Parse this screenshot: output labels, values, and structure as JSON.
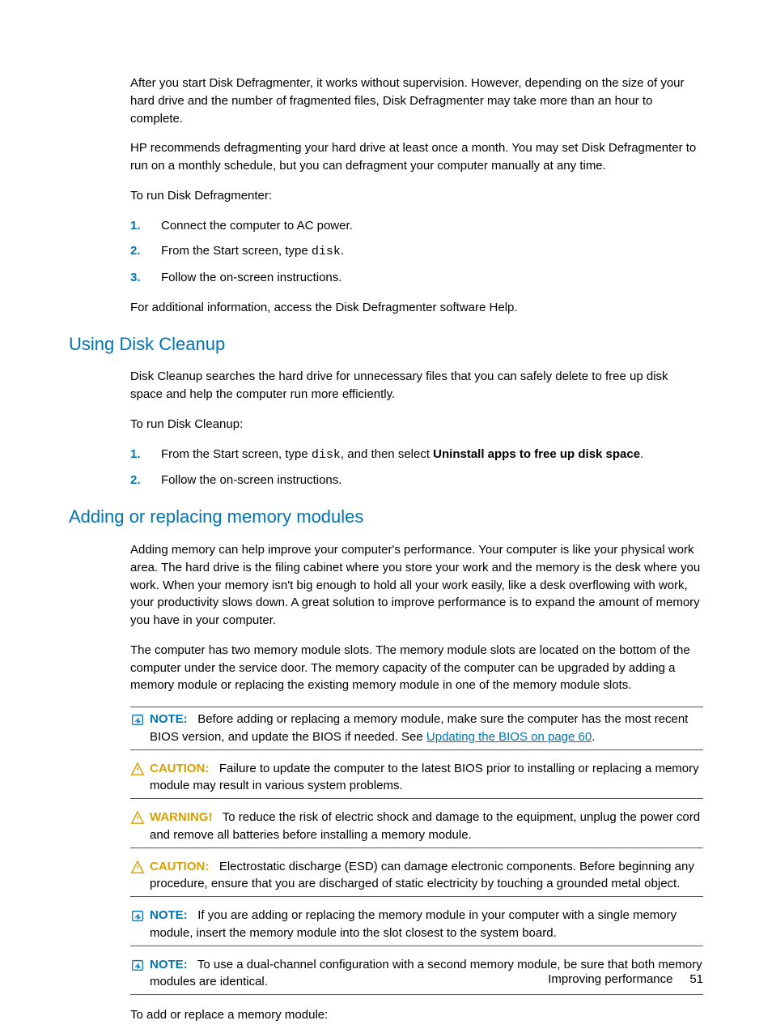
{
  "intro": {
    "p1": "After you start Disk Defragmenter, it works without supervision. However, depending on the size of your hard drive and the number of fragmented files, Disk Defragmenter may take more than an hour to complete.",
    "p2": "HP recommends defragmenting your hard drive at least once a month. You may set Disk Defragmenter to run on a monthly schedule, but you can defragment your computer manually at any time.",
    "p3": "To run Disk Defragmenter:",
    "steps": {
      "n1": "1.",
      "t1": "Connect the computer to AC power.",
      "n2": "2.",
      "t2a": "From the Start screen, type ",
      "t2code": "disk",
      "t2b": ".",
      "n3": "3.",
      "t3": "Follow the on-screen instructions."
    },
    "p4": "For additional information, access the Disk Defragmenter software Help."
  },
  "cleanup": {
    "heading": "Using Disk Cleanup",
    "p1": "Disk Cleanup searches the hard drive for unnecessary files that you can safely delete to free up disk space and help the computer run more efficiently.",
    "p2": "To run Disk Cleanup:",
    "steps": {
      "n1": "1.",
      "t1a": "From the Start screen, type ",
      "t1code": "disk",
      "t1b": ", and then select ",
      "t1bold": "Uninstall apps to free up disk space",
      "t1c": ".",
      "n2": "2.",
      "t2": "Follow the on-screen instructions."
    }
  },
  "memory": {
    "heading": "Adding or replacing memory modules",
    "p1": "Adding memory can help improve your computer's performance. Your computer is like your physical work area. The hard drive is the filing cabinet where you store your work and the memory is the desk where you work. When your memory isn't big enough to hold all your work easily, like a desk overflowing with work, your productivity slows down. A great solution to improve performance is to expand the amount of memory you have in your computer.",
    "p2": "The computer has two memory module slots. The memory module slots are located on the bottom of the computer under the service door. The memory capacity of the computer can be upgraded by adding a memory module or replacing the existing memory module in one of the memory module slots.",
    "note1_label": "NOTE:",
    "note1_a": "Before adding or replacing a memory module, make sure the computer has the most recent BIOS version, and update the BIOS if needed. See ",
    "note1_link": "Updating the BIOS on page 60",
    "note1_b": ".",
    "caution1_label": "CAUTION:",
    "caution1": "Failure to update the computer to the latest BIOS prior to installing or replacing a memory module may result in various system problems.",
    "warning1_label": "WARNING!",
    "warning1": "To reduce the risk of electric shock and damage to the equipment, unplug the power cord and remove all batteries before installing a memory module.",
    "caution2_label": "CAUTION:",
    "caution2": "Electrostatic discharge (ESD) can damage electronic components. Before beginning any procedure, ensure that you are discharged of static electricity by touching a grounded metal object.",
    "note2_label": "NOTE:",
    "note2": "If you are adding or replacing the memory module in your computer with a single memory module, insert the memory module into the slot closest to the system board.",
    "note3_label": "NOTE:",
    "note3": "To use a dual-channel configuration with a second memory module, be sure that both memory modules are identical.",
    "p3": "To add or replace a memory module:"
  },
  "footer": {
    "text": "Improving performance",
    "pagenum": "51"
  }
}
